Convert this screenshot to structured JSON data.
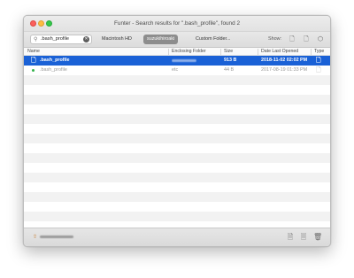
{
  "window": {
    "title": "Funter - Search results for \".bash_profile\", found 2"
  },
  "toolbar": {
    "search_value": ".bash_profile",
    "search_icon": "magnifier-icon",
    "clear_icon": "clear-icon",
    "scopes": [
      "Macintosh HD",
      "suzukihiroaki",
      "Custom Folder..."
    ],
    "selected_scope": "suzukihiroaki",
    "show_label": "Show:",
    "show_icons": [
      "visible-file-icon",
      "hidden-file-icon",
      "package-icon"
    ]
  },
  "table": {
    "headers": [
      "Name",
      "Enclosing Folder",
      "Size",
      "Date Last Opened",
      "Type"
    ],
    "rows": [
      {
        "name": ".bash_profile",
        "folder": "",
        "size": "913 B",
        "date": "2018-11-02 02:02 PM",
        "selected": true
      },
      {
        "name": ".bash_profile",
        "folder": "etc",
        "size": "44 B",
        "date": "2017-08-19 01:33 PM",
        "selected": false
      }
    ]
  },
  "bottombar": {
    "path_icon": "home-folder-icon",
    "actions": [
      "open-file-icon",
      "reveal-in-finder-icon",
      "trash-icon"
    ]
  },
  "colors": {
    "selection": "#1a61d6",
    "stripe": "#f2f2f2",
    "close": "#fc605c",
    "minimize": "#fdbc40",
    "maximize": "#34c84a"
  }
}
